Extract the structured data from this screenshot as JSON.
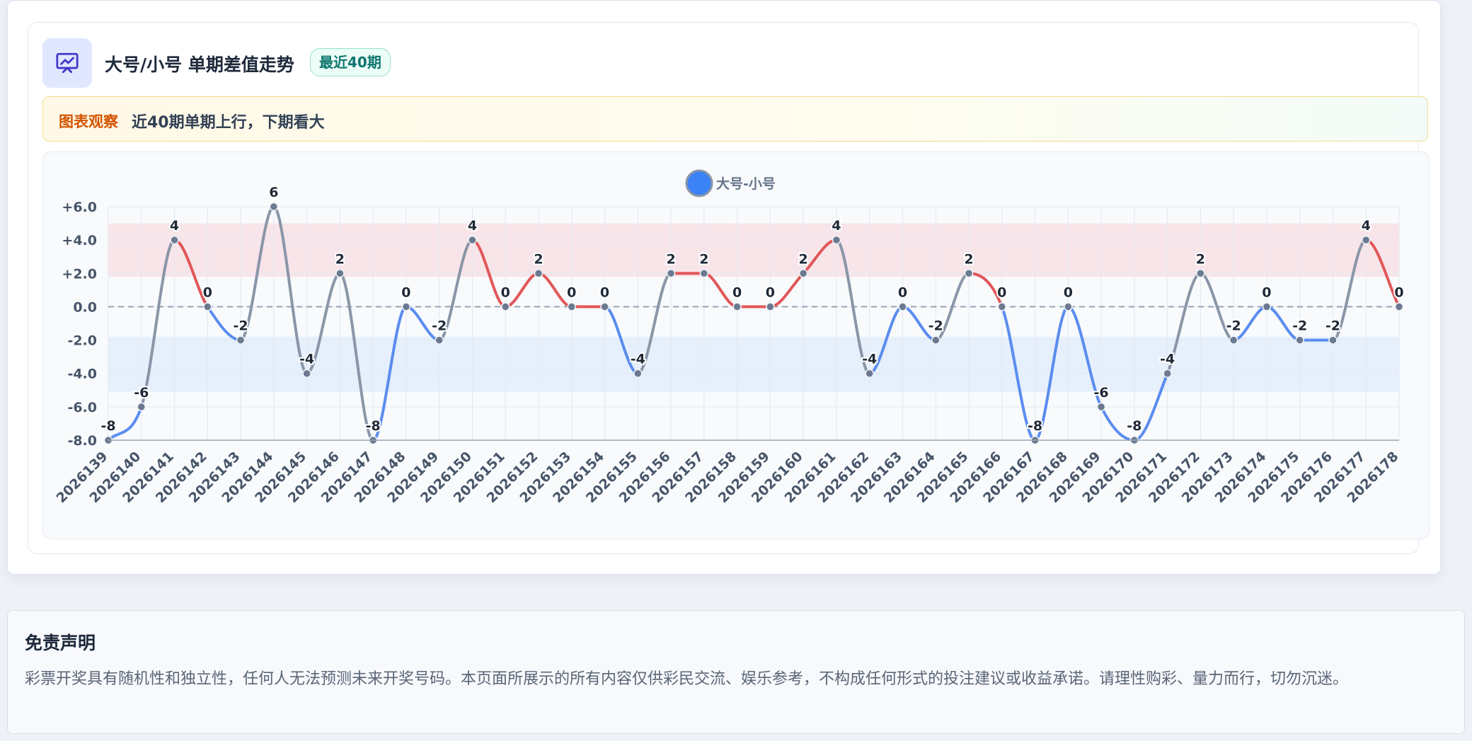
{
  "header": {
    "title": "大号/小号 单期差值走势",
    "badge": "最近40期",
    "icon": "presentation-chart-icon"
  },
  "observation": {
    "tag": "图表观察",
    "text": "近40期单期上行，下期看大"
  },
  "colors": {
    "up": "#e15759",
    "down": "#5b8def",
    "flat": "#8a96a8",
    "point": "#6b7a90",
    "accent_legend": "#3b82f6"
  },
  "chart_data": {
    "type": "line",
    "legend": {
      "label": "大号-小号",
      "placement": "top-center"
    },
    "categories": [
      "2026139",
      "2026140",
      "2026141",
      "2026142",
      "2026143",
      "2026144",
      "2026145",
      "2026146",
      "2026147",
      "2026148",
      "2026149",
      "2026150",
      "2026151",
      "2026152",
      "2026153",
      "2026154",
      "2026155",
      "2026156",
      "2026157",
      "2026158",
      "2026159",
      "2026160",
      "2026161",
      "2026162",
      "2026163",
      "2026164",
      "2026165",
      "2026166",
      "2026167",
      "2026168",
      "2026169",
      "2026170",
      "2026171",
      "2026172",
      "2026173",
      "2026174",
      "2026175",
      "2026176",
      "2026177",
      "2026178"
    ],
    "series": [
      {
        "name": "大号-小号",
        "values": [
          -8,
          -6,
          4,
          0,
          -2,
          6,
          -4,
          2,
          -8,
          0,
          -2,
          4,
          0,
          2,
          0,
          0,
          -4,
          2,
          2,
          0,
          0,
          2,
          4,
          -4,
          0,
          -2,
          2,
          0,
          -8,
          0,
          -6,
          -8,
          -4,
          2,
          -2,
          0,
          -2,
          -2,
          4,
          0
        ]
      }
    ],
    "ylim": [
      -8,
      6
    ],
    "yticks": [
      "+6.0",
      "+4.0",
      "+2.0",
      "0.0",
      "-2.0",
      "-4.0",
      "-6.0",
      "-8.0"
    ],
    "ytick_values": [
      6,
      4,
      2,
      0,
      -2,
      -4,
      -6,
      -8
    ],
    "bands": [
      {
        "from": 1.8,
        "to": 5,
        "color": "#f8d7dc"
      },
      {
        "from": -5.1,
        "to": -1.8,
        "color": "#dbe7fb"
      }
    ],
    "reference_line": 0,
    "grid": true
  },
  "disclaimer": {
    "title": "免责声明",
    "text": "彩票开奖具有随机性和独立性，任何人无法预测未来开奖号码。本页面所展示的所有内容仅供彩民交流、娱乐参考，不构成任何形式的投注建议或收益承诺。请理性购彩、量力而行，切勿沉迷。"
  }
}
